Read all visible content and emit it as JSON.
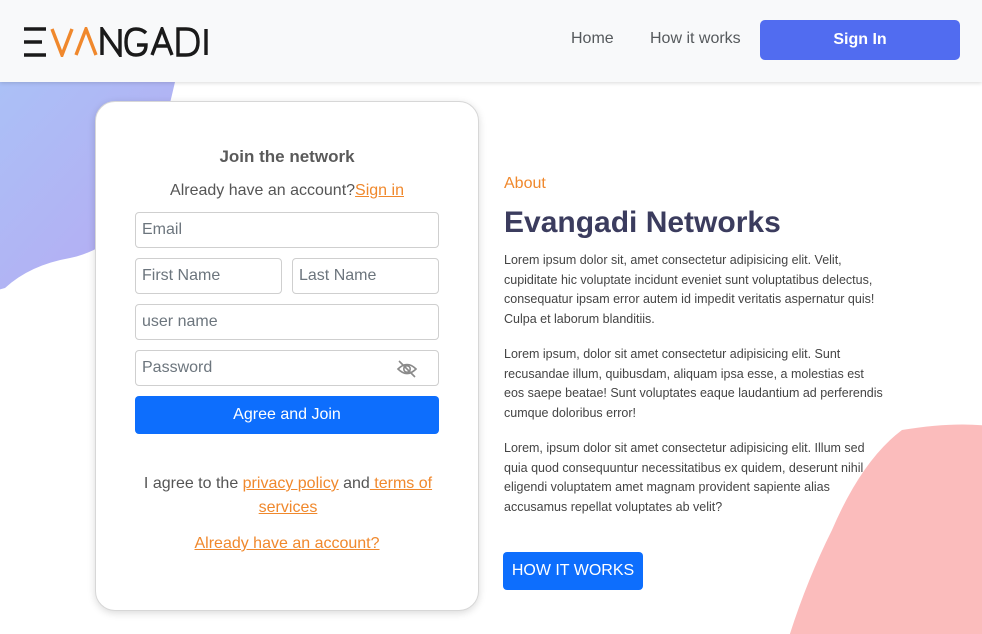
{
  "brand": {
    "logo_text": "EVANGADI",
    "accent": "#f0882c",
    "primary": "#0d6efd",
    "signin_color": "#516cf0"
  },
  "nav": {
    "home": "Home",
    "how": "How it works",
    "signin": "Sign In"
  },
  "form": {
    "title": "Join the network",
    "already_prefix": "Already have an account?",
    "already_link": "Sign in",
    "email_placeholder": "Email",
    "first_placeholder": "First Name",
    "last_placeholder": "Last Name",
    "username_placeholder": "user name",
    "password_placeholder": "Password",
    "password_toggle_icon": "eye-slash-icon",
    "join_button": "Agree and Join",
    "agree_prefix": "I agree to the ",
    "privacy_link": "privacy policy",
    "agree_mid": " and",
    "terms_link": " terms of services",
    "bottom_link": "Already have an account?"
  },
  "about": {
    "label": "About",
    "title": "Evangadi Networks",
    "p1": "Lorem ipsum dolor sit, amet consectetur adipisicing elit. Velit, cupiditate hic voluptate incidunt eveniet sunt voluptatibus delectus, consequatur ipsam error autem id impedit veritatis aspernatur quis! Culpa et laborum blanditiis.",
    "p2": "Lorem ipsum, dolor sit amet consectetur adipisicing elit. Sunt recusandae illum, quibusdam, aliquam ipsa esse, a molestias est eos saepe beatae! Sunt voluptates eaque laudantium ad perferendis cumque doloribus error!",
    "p3": "Lorem, ipsum dolor sit amet consectetur adipisicing elit. Illum sed quia quod consequuntur necessitatibus ex quidem, deserunt nihil eligendi voluptatem amet magnam provident sapiente alias accusamus repellat voluptates ab velit?",
    "button": "HOW IT WORKS"
  }
}
